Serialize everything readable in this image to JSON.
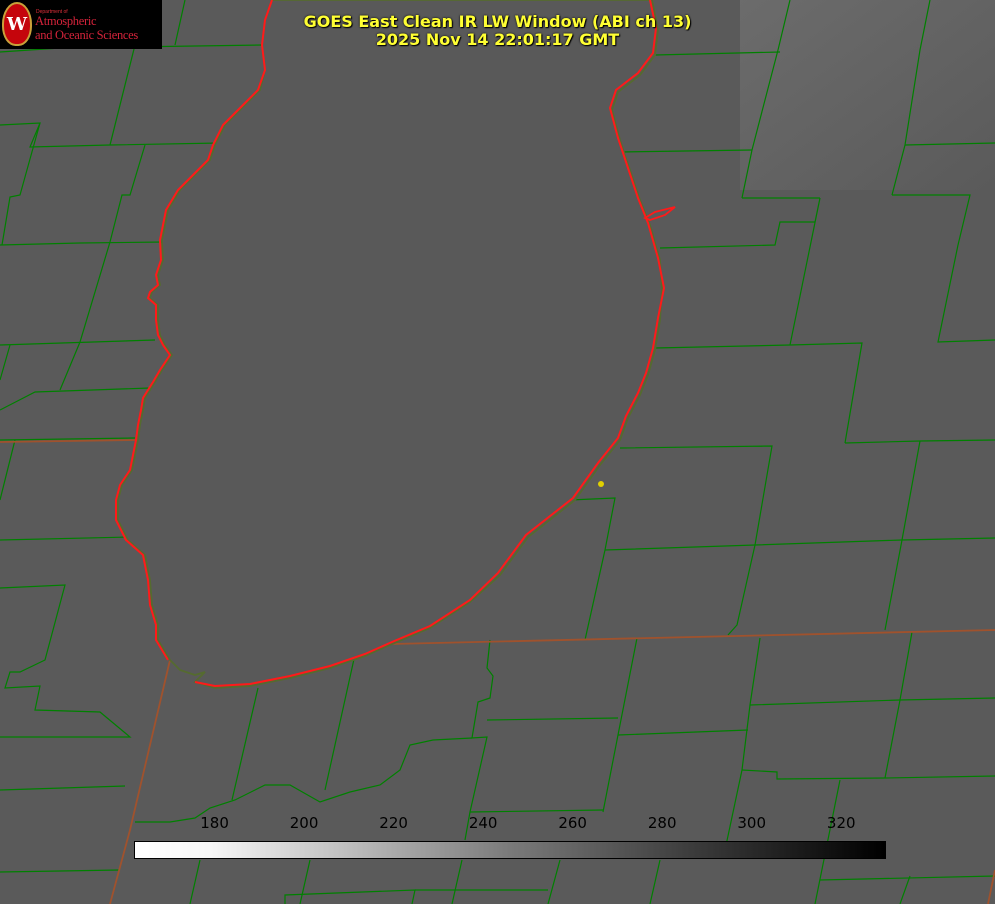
{
  "title_line1": "GOES East Clean IR LW Window (ABI ch 13)",
  "title_line2": "2025 Nov 14 22:01:17 GMT",
  "logo": {
    "dept": "Department of",
    "line1": "Atmospheric",
    "line2": "and Oceanic Sciences",
    "seal_letter": "W"
  },
  "colorbar": {
    "min": 162,
    "max": 330,
    "ticks": [
      "180",
      "200",
      "220",
      "240",
      "260",
      "280",
      "300",
      "320"
    ]
  },
  "colors": {
    "background": "#5a5a5a",
    "lake_fill": "#595959",
    "county_lines": "#008000",
    "state_lines": "#c0392b",
    "coastline": "#ff1a1a",
    "title": "#ffff33",
    "station_dot": "#e0d000"
  }
}
